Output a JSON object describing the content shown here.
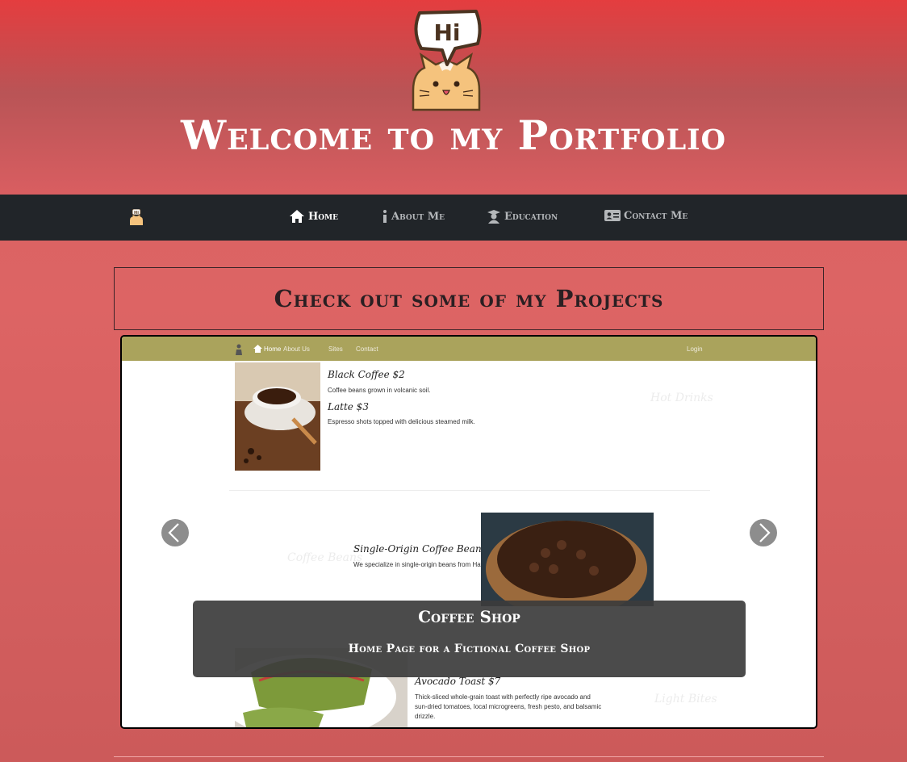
{
  "header": {
    "logo_text": "Hi",
    "title": "Welcome to my Portfolio"
  },
  "navbar": {
    "brand_icon": "hi-cat-icon",
    "items": [
      {
        "label": "Home",
        "icon": "home-icon",
        "active": true
      },
      {
        "label": "About Me",
        "icon": "info-icon",
        "active": false
      },
      {
        "label": "Education",
        "icon": "graduate-icon",
        "active": false
      },
      {
        "label": "Contact Me",
        "icon": "contact-card-icon",
        "active": false
      }
    ]
  },
  "projects": {
    "heading": "Check out some of my Projects"
  },
  "carousel": {
    "slide": {
      "nav": {
        "home": "Home",
        "about": "About Us",
        "sites": "Sites",
        "contact": "Contact",
        "login": "Login"
      },
      "menu": [
        {
          "name": "Black Coffee $2",
          "desc": "Coffee beans grown in volcanic soil."
        },
        {
          "name": "Latte $3",
          "desc": "Espresso shots topped with delicious steamed milk."
        },
        {
          "name": "Single-Origin Coffee Beans",
          "desc": "We specialize in single-origin beans from Hawaii."
        },
        {
          "name": "Avocado Toast $7",
          "desc_lines": [
            "Thick-sliced whole-grain toast with perfectly ripe avocado and",
            "sun-dried tomatoes, local microgreens, fresh pesto, and balsamic",
            "drizzle."
          ]
        }
      ],
      "section_labels": [
        "Hot Drinks",
        "Coffee Beans",
        "Light Bites"
      ]
    },
    "caption": {
      "title": "Coffee Shop",
      "subtitle": "Home Page for a Fictional Coffee Shop"
    },
    "prev_icon": "chevron-left-icon",
    "next_icon": "chevron-right-icon"
  },
  "colors": {
    "header_top": "#e43d3f",
    "header_mid": "#b95456",
    "page_bg": "#d66060",
    "navbar_bg": "#212529",
    "slide_nav_bg": "#aaa35c",
    "caption_bg": "#3c3c3c"
  }
}
